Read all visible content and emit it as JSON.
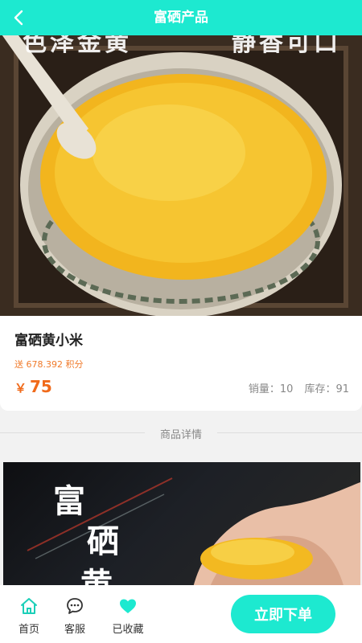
{
  "header": {
    "title": "富硒产品"
  },
  "hero": {
    "banner_left": "色泽金黄",
    "banner_right": "静香可口"
  },
  "product": {
    "name": "富硒黄小米",
    "points_text": "送 678.392 积分",
    "price_symbol": "￥",
    "price": "75",
    "sales_text": "销量：10",
    "stock_text": "库存：91"
  },
  "detail": {
    "section_label": "商品详情",
    "image_chars": [
      "富",
      "硒",
      "黄"
    ]
  },
  "bottom_nav": {
    "tabs": [
      {
        "label": "首页",
        "icon": "home-icon"
      },
      {
        "label": "客服",
        "icon": "chat-icon"
      },
      {
        "label": "已收藏",
        "icon": "heart-icon"
      }
    ],
    "order_label": "立即下单"
  },
  "colors": {
    "accent": "#1de9d0",
    "price": "#f06a1a"
  }
}
